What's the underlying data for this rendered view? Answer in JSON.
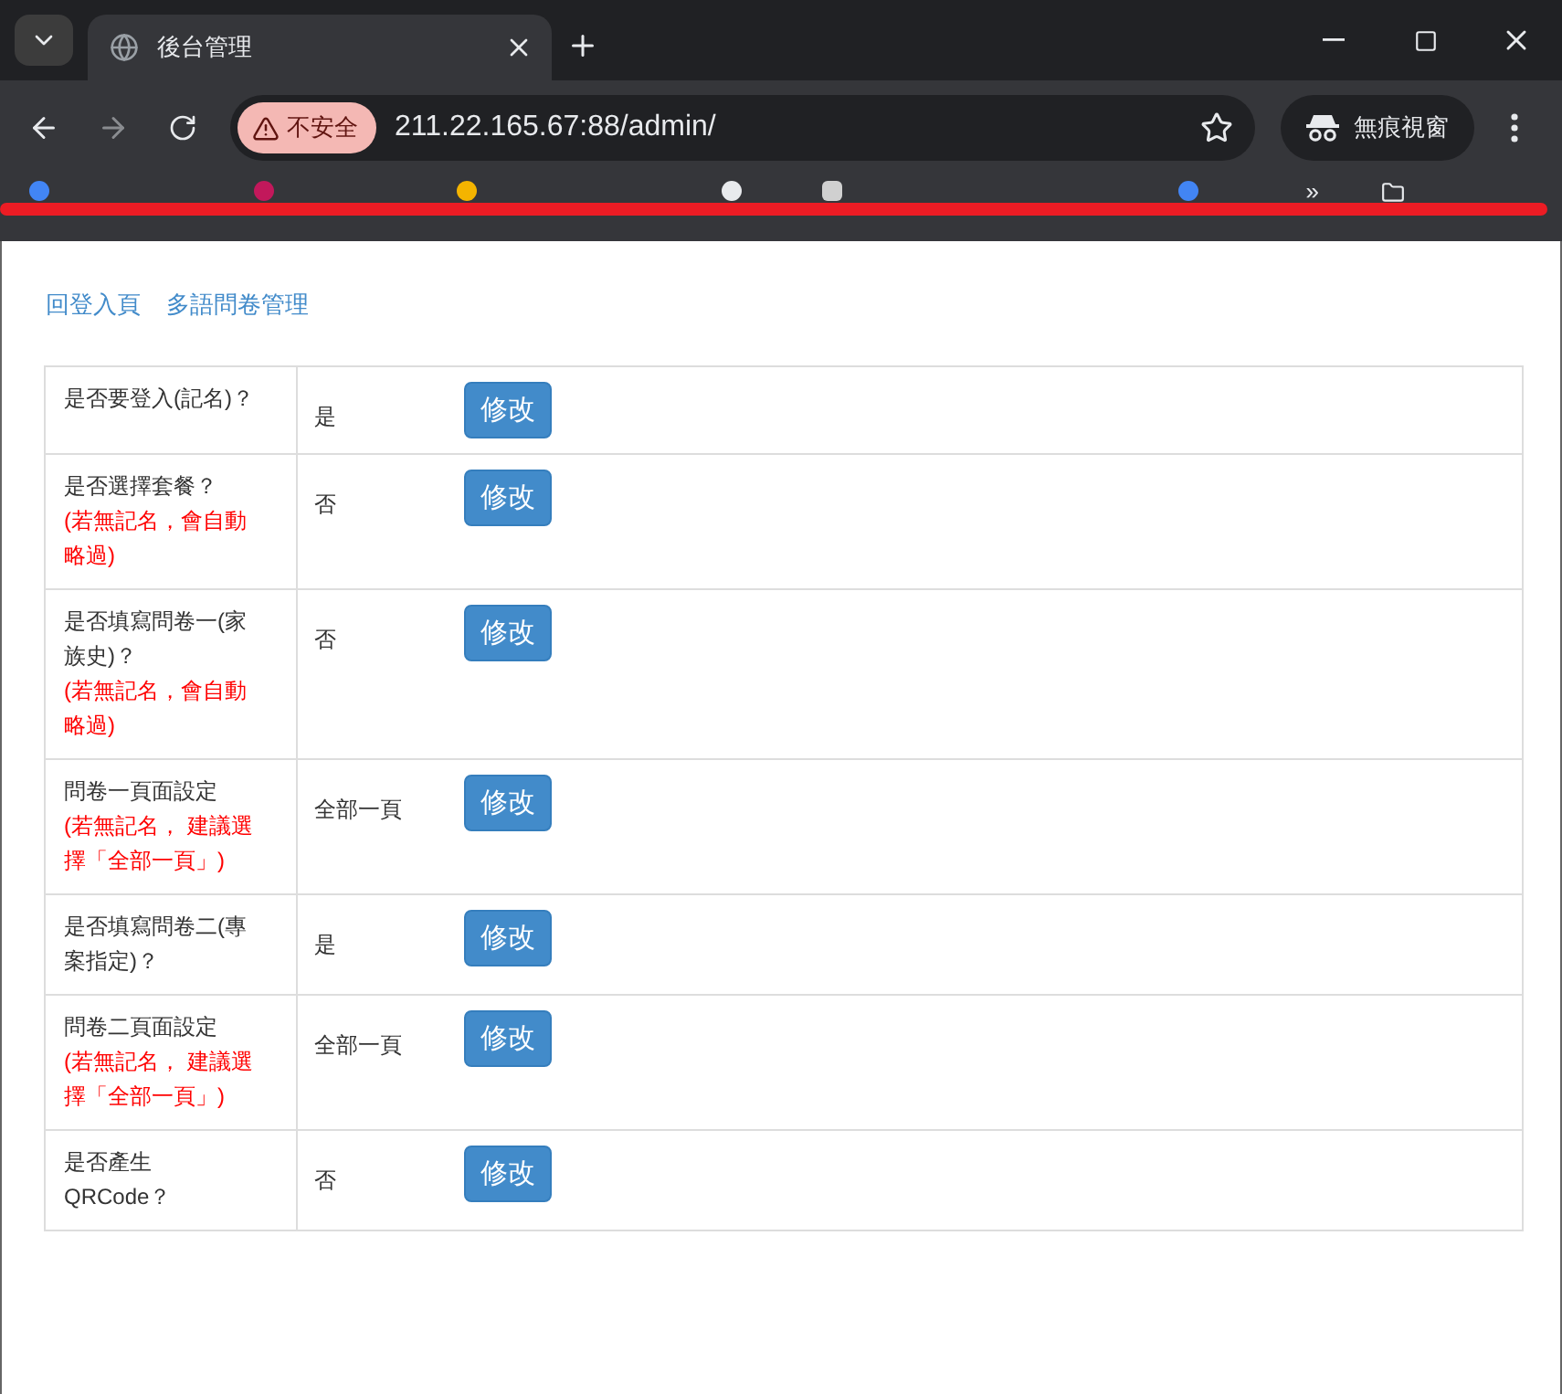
{
  "browser": {
    "tab_title": "後台管理",
    "security_label": "不安全",
    "url": "211.22.165.67:88/admin/",
    "incognito_label": "無痕視窗",
    "bookmarks_overflow": "»"
  },
  "nav_links": [
    "回登入頁",
    "多語問卷管理"
  ],
  "settings": [
    {
      "question": "是否要登入(記名)？",
      "value": "是",
      "button": "修改"
    },
    {
      "question": "是否選擇套餐？",
      "note": "(若無記名，會自動略過)",
      "value": "否",
      "button": "修改"
    },
    {
      "question": "是否填寫問卷一(家族史)？",
      "note": "(若無記名，會自動略過)",
      "value": "否",
      "button": "修改"
    },
    {
      "question": "問卷一頁面設定",
      "note": "(若無記名， 建議選擇「全部一頁」)",
      "value": "全部一頁",
      "button": "修改"
    },
    {
      "question": "是否填寫問卷二(專案指定)？",
      "value": "是",
      "button": "修改"
    },
    {
      "question": "問卷二頁面設定",
      "note": "(若無記名， 建議選擇「全部一頁」)",
      "value": "全部一頁",
      "button": "修改"
    },
    {
      "question": "是否產生QRCode？",
      "value": "否",
      "button": "修改"
    }
  ]
}
